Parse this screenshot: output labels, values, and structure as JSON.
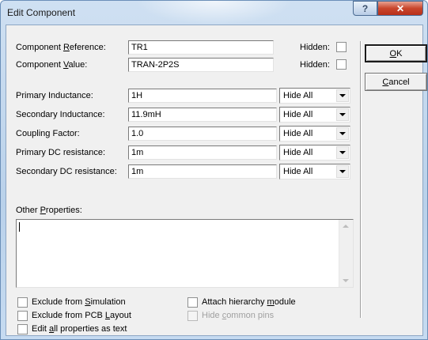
{
  "window": {
    "title": "Edit Component"
  },
  "titlebar": {
    "help_glyph": "?",
    "close_glyph": "✕"
  },
  "reference": {
    "label_pre": "Component ",
    "label_key": "R",
    "label_post": "eference:",
    "value": "TR1",
    "hidden_label": "Hidden:"
  },
  "value_row": {
    "label_pre": "Component ",
    "label_key": "V",
    "label_post": "alue:",
    "value": "TRAN-2P2S",
    "hidden_label": "Hidden:"
  },
  "properties": [
    {
      "label": "Primary Inductance:",
      "value": "1H",
      "visibility": "Hide All"
    },
    {
      "label": "Secondary Inductance:",
      "value": "11.9mH",
      "visibility": "Hide All"
    },
    {
      "label": "Coupling Factor:",
      "value": "1.0",
      "visibility": "Hide All"
    },
    {
      "label": "Primary DC resistance:",
      "value": "1m",
      "visibility": "Hide All"
    },
    {
      "label": "Secondary DC resistance:",
      "value": "1m",
      "visibility": "Hide All"
    }
  ],
  "other": {
    "label_pre": "Other ",
    "label_key": "P",
    "label_post": "roperties:",
    "value": ""
  },
  "options": {
    "exclude_sim": {
      "pre": "Exclude from ",
      "key": "S",
      "post": "imulation"
    },
    "exclude_pcb": {
      "pre": "Exclude from PCB ",
      "key": "L",
      "post": "ayout"
    },
    "edit_all": {
      "pre": "Edit ",
      "key": "a",
      "post": "ll properties as text"
    },
    "attach": {
      "pre": "Attach hierarchy ",
      "key": "m",
      "post": "odule"
    },
    "hide_pins": {
      "pre": "Hide ",
      "key": "c",
      "post": "ommon pins"
    }
  },
  "buttons": {
    "ok": {
      "key": "O",
      "post": "K"
    },
    "cancel": {
      "key": "C",
      "post": "ancel"
    }
  }
}
